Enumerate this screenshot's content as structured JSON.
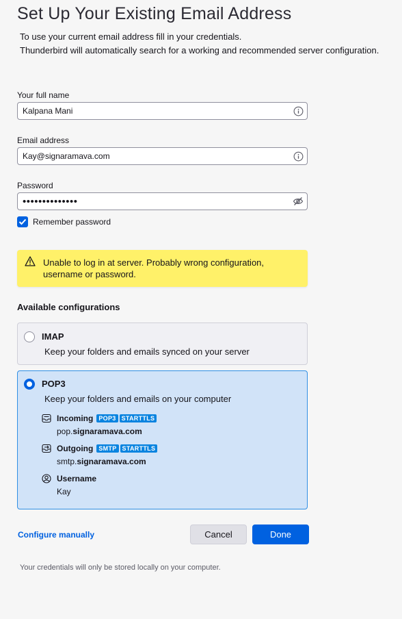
{
  "header": {
    "title": "Set Up Your Existing Email Address",
    "subtitle_line1": "To use your current email address fill in your credentials.",
    "subtitle_line2": "Thunderbird will automatically search for a working and recommended server configuration."
  },
  "form": {
    "full_name": {
      "label": "Your full name",
      "value": "Kalpana Mani",
      "icon": "info-icon"
    },
    "email": {
      "label": "Email address",
      "value": "Kay@signaramava.com",
      "icon": "info-icon"
    },
    "password": {
      "label": "Password",
      "value": "••••••••••••••",
      "icon": "eye-hidden-icon"
    },
    "remember": {
      "label": "Remember password",
      "checked": true
    }
  },
  "warning": {
    "icon": "warning-icon",
    "text": "Unable to log in at server. Probably wrong configuration, username or password."
  },
  "configurations": {
    "title": "Available configurations",
    "imap": {
      "name": "IMAP",
      "description": "Keep your folders and emails synced on your server",
      "selected": false
    },
    "pop3": {
      "name": "POP3",
      "description": "Keep your folders and emails on your computer",
      "selected": true,
      "incoming": {
        "label": "Incoming",
        "protocol": "POP3",
        "security": "STARTTLS",
        "host_prefix": "pop.",
        "host_domain": "signaramava.com"
      },
      "outgoing": {
        "label": "Outgoing",
        "protocol": "SMTP",
        "security": "STARTTLS",
        "host_prefix": "smtp.",
        "host_domain": "signaramava.com"
      },
      "username": {
        "label": "Username",
        "value": "Kay"
      }
    }
  },
  "actions": {
    "configure_manually": "Configure manually",
    "cancel": "Cancel",
    "done": "Done"
  },
  "footer": "Your credentials will only be stored locally on your computer.",
  "colors": {
    "accent": "#0061e0",
    "warning_bg": "#fff169",
    "selected_bg": "#d1e3f8",
    "badge": "#0a84e0"
  }
}
